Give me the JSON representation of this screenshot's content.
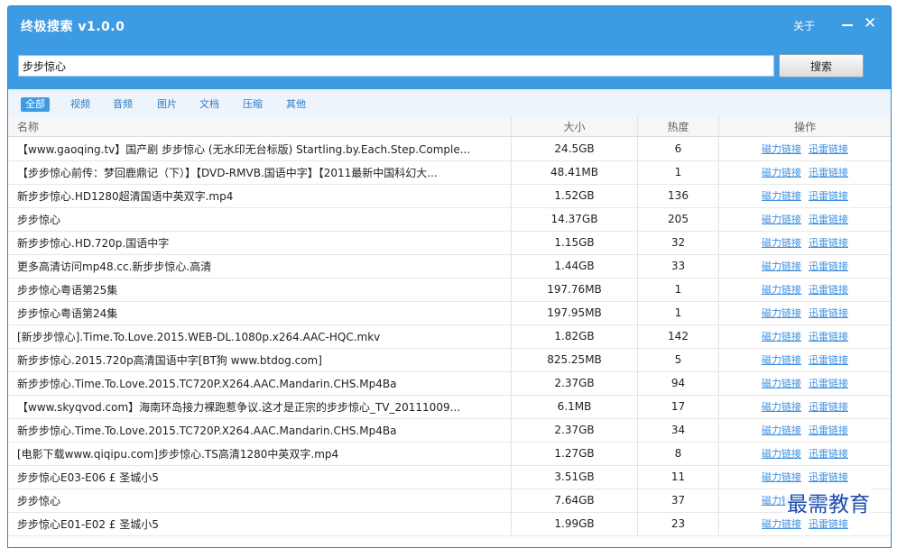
{
  "window": {
    "title": "终极搜索 v1.0.0",
    "about": "关于",
    "close_glyph": "✕"
  },
  "search": {
    "value": "步步惊心",
    "button": "搜索"
  },
  "tabs": [
    "全部",
    "视频",
    "音频",
    "图片",
    "文档",
    "压缩",
    "其他"
  ],
  "active_tab": "全部",
  "table": {
    "headers": {
      "name": "名称",
      "size": "大小",
      "heat": "热度",
      "ops": "操作"
    },
    "link_labels": {
      "magnet": "磁力链接",
      "thunder": "迅雷链接"
    },
    "rows": [
      {
        "name": "【www.gaoqing.tv】国产剧 步步惊心 (无水印无台标版) Startling.by.Each.Step.Comple...",
        "size": "24.5GB",
        "heat": "6"
      },
      {
        "name": "【步步惊心前传：梦回鹿鼎记（下）】【DVD-RMVB.国语中字】【2011最新中国科幻大...",
        "size": "48.41MB",
        "heat": "1"
      },
      {
        "name": "新步步惊心.HD1280超清国语中英双字.mp4",
        "size": "1.52GB",
        "heat": "136"
      },
      {
        "name": "步步惊心",
        "size": "14.37GB",
        "heat": "205"
      },
      {
        "name": "新步步惊心.HD.720p.国语中字",
        "size": "1.15GB",
        "heat": "32"
      },
      {
        "name": "更多高清访问mp48.cc.新步步惊心.高清",
        "size": "1.44GB",
        "heat": "33"
      },
      {
        "name": "步步惊心粤语第25集",
        "size": "197.76MB",
        "heat": "1"
      },
      {
        "name": "步步惊心粤语第24集",
        "size": "197.95MB",
        "heat": "1"
      },
      {
        "name": "[新步步惊心].Time.To.Love.2015.WEB-DL.1080p.x264.AAC-HQC.mkv",
        "size": "1.82GB",
        "heat": "142"
      },
      {
        "name": "新步步惊心.2015.720p高清国语中字[BT狗 www.btdog.com]",
        "size": "825.25MB",
        "heat": "5"
      },
      {
        "name": "新步步惊心.Time.To.Love.2015.TC720P.X264.AAC.Mandarin.CHS.Mp4Ba",
        "size": "2.37GB",
        "heat": "94"
      },
      {
        "name": "【www.skyqvod.com】海南环岛接力裸跑惹争议.这才是正宗的步步惊心_TV_20111009...",
        "size": "6.1MB",
        "heat": "17"
      },
      {
        "name": "新步步惊心.Time.To.Love.2015.TC720P.X264.AAC.Mandarin.CHS.Mp4Ba",
        "size": "2.37GB",
        "heat": "34"
      },
      {
        "name": "[电影下载www.qiqipu.com]步步惊心.TS高清1280中英双字.mp4",
        "size": "1.27GB",
        "heat": "8"
      },
      {
        "name": "步步惊心E03-E06 £ 圣城小5",
        "size": "3.51GB",
        "heat": "11"
      },
      {
        "name": "步步惊心",
        "size": "7.64GB",
        "heat": "37"
      },
      {
        "name": "步步惊心E01-E02 £ 圣城小5",
        "size": "1.99GB",
        "heat": "23"
      }
    ]
  },
  "watermark": "最需教育",
  "colors": {
    "titlebar": "#3d9be4",
    "link": "#3a8ee0",
    "active_tab": "#3d9be4",
    "watermark": "#1e4fae"
  }
}
